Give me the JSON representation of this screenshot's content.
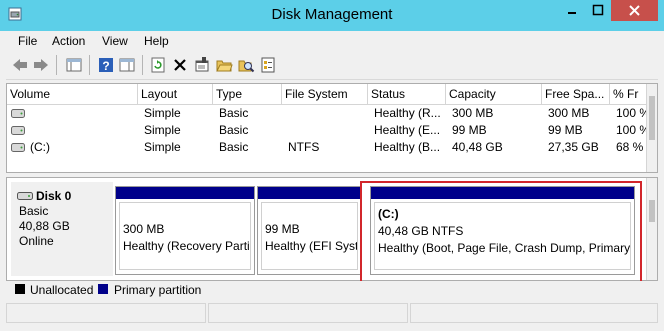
{
  "window": {
    "title": "Disk Management",
    "accent_color": "#5ccfe8",
    "close_color": "#c7504b",
    "icon": "disk-management-icon"
  },
  "menu": {
    "items": [
      "File",
      "Action",
      "View",
      "Help"
    ]
  },
  "toolbar": {
    "buttons": [
      {
        "icon": "back-arrow-icon"
      },
      {
        "icon": "forward-arrow-icon"
      },
      {
        "icon": "show-hide-console-tree-icon"
      },
      {
        "icon": "help-icon"
      },
      {
        "icon": "show-hide-action-pane-icon"
      },
      {
        "icon": "refresh-icon"
      },
      {
        "icon": "delete-icon"
      },
      {
        "icon": "properties-icon"
      },
      {
        "icon": "open-icon"
      },
      {
        "icon": "explore-icon"
      },
      {
        "icon": "settings-list-icon"
      }
    ]
  },
  "volume_list": {
    "columns": [
      "Volume",
      "Layout",
      "Type",
      "File System",
      "Status",
      "Capacity",
      "Free Spa...",
      "% Fr"
    ],
    "rows": [
      [
        "",
        "Simple",
        "Basic",
        "",
        "Healthy (R...",
        "300 MB",
        "300 MB",
        "100 %"
      ],
      [
        "",
        "Simple",
        "Basic",
        "",
        "Healthy (E...",
        "99 MB",
        "99 MB",
        "100 %"
      ],
      [
        "(C:)",
        "Simple",
        "Basic",
        "NTFS",
        "Healthy (B...",
        "40,48 GB",
        "27,35 GB",
        "68 %"
      ]
    ]
  },
  "disk": {
    "name": "Disk 0",
    "type": "Basic",
    "size": "40,88 GB",
    "status": "Online",
    "partitions": [
      {
        "title": "",
        "size": "300 MB",
        "status": "Healthy (Recovery Partit"
      },
      {
        "title": "",
        "size": "99 MB",
        "status": "Healthy (EFI Syster"
      },
      {
        "title": "(C:)",
        "size": "40,48 GB NTFS",
        "status": "Healthy (Boot, Page File, Crash Dump, Primary P"
      }
    ],
    "partition_color": "#00008a",
    "highlight_color": "#d2262b"
  },
  "legend": {
    "items": [
      {
        "label": "Unallocated",
        "color": "#000000"
      },
      {
        "label": "Primary partition",
        "color": "#00008a"
      }
    ]
  }
}
